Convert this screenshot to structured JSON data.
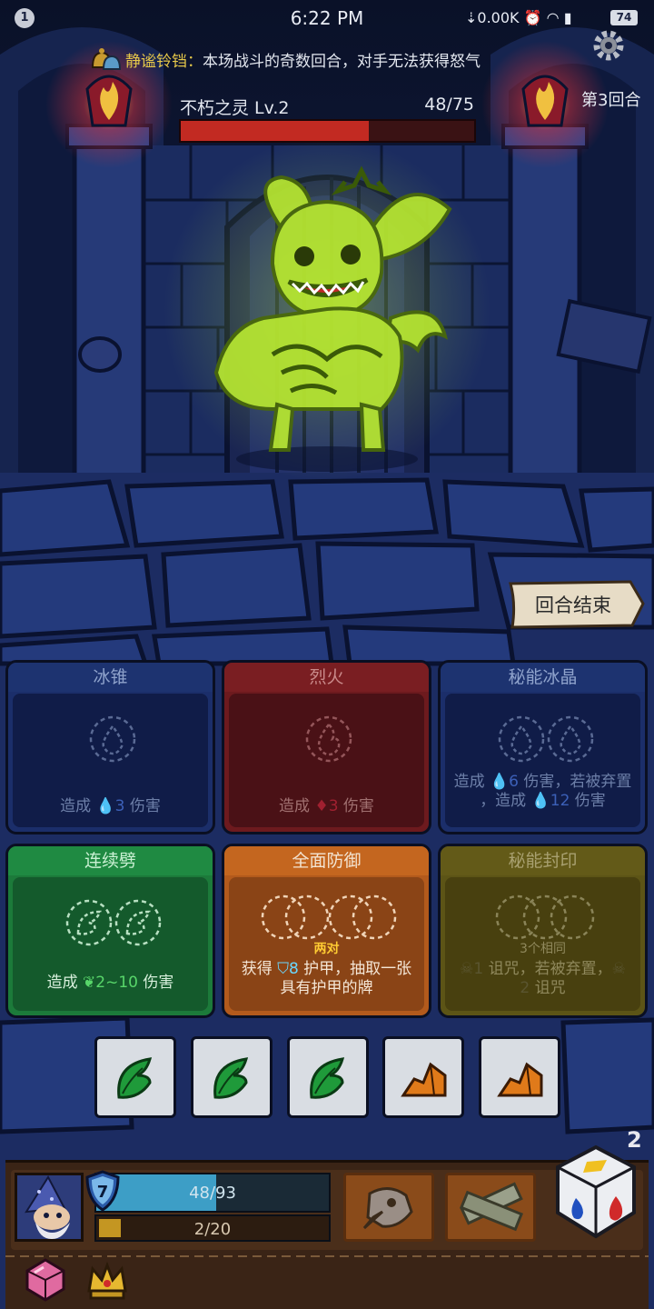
{
  "status_bar": {
    "notification_count": "1",
    "time": "6:22 PM",
    "net_speed": "0.00K",
    "battery": "74"
  },
  "relic_tip": {
    "name": "静谧铃铛：",
    "description": "本场战斗的奇数回合，对手无法获得怒气"
  },
  "round_label": "第3回合",
  "enemy": {
    "name": "不朽之灵 Lv.2",
    "hp_text": "48/75",
    "hp_fraction": 0.64
  },
  "end_turn_label": "回合结束",
  "cards": [
    {
      "title": "冰锥",
      "effect": [
        "造成 ",
        "3",
        " 伤害"
      ],
      "theme": "blue"
    },
    {
      "title": "烈火",
      "effect": [
        "造成 ",
        "3",
        " 伤害"
      ],
      "theme": "red"
    },
    {
      "title": "秘能冰晶",
      "effect_l1": [
        "造成 ",
        "6",
        " 伤害，若被弃置"
      ],
      "effect_l2": [
        "，造成 ",
        "12",
        " 伤害"
      ],
      "theme": "blue"
    },
    {
      "title": "连续劈",
      "effect": [
        "造成 ",
        "2~10",
        " 伤害"
      ],
      "theme": "green"
    },
    {
      "title": "全面防御",
      "requirement": "两对",
      "effect_l1": [
        "获得 ",
        "8",
        " 护甲，抽取一张"
      ],
      "effect_l2": "具有护甲的牌",
      "theme": "orange"
    },
    {
      "title": "秘能封印",
      "requirement": "3个相同",
      "effect_l1": [
        "1",
        " 诅咒，若被弃置，",
        ""
      ],
      "effect_l2": [
        "2",
        " 诅咒"
      ],
      "theme": "olive"
    }
  ],
  "dice": [
    {
      "face": "green-leaf-icon"
    },
    {
      "face": "green-leaf-icon"
    },
    {
      "face": "green-leaf-icon"
    },
    {
      "face": "orange-shard-icon"
    },
    {
      "face": "orange-shard-icon"
    }
  ],
  "player": {
    "armor": "7",
    "hp_text": "48/93",
    "hp_fraction": 0.516,
    "energy_text": "2/20",
    "energy_fraction": 0.1
  },
  "reroll_count": "2",
  "colors": {
    "enemy_hp": "#c22a22",
    "player_hp": "#3d9ec6",
    "relic_name": "#e6c84a"
  }
}
